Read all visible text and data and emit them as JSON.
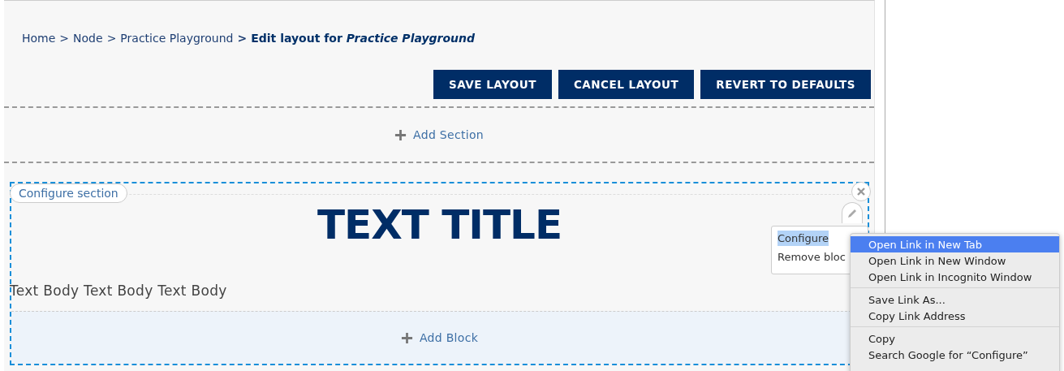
{
  "breadcrumb": {
    "links": [
      "Home",
      "Node",
      "Practice Playground"
    ],
    "separators": [
      ">",
      ">",
      ">"
    ],
    "current": "Edit layout for *Practice Playground*"
  },
  "actions": [
    "SAVE LAYOUT",
    "CANCEL LAYOUT",
    "REVERT TO DEFAULTS"
  ],
  "add_section": "Add Section",
  "section": {
    "configure": "Configure section",
    "title": "TEXT TITLE",
    "body": "Text Body Text Body Text Body",
    "add_block": "Add Block",
    "block_menu": [
      {
        "label": "Configure",
        "selected": true
      },
      {
        "label": "Remove bloc",
        "selected": false
      }
    ]
  },
  "context_menu": [
    [
      {
        "label": "Open Link in New Tab",
        "selected": true
      },
      {
        "label": "Open Link in New Window",
        "selected": false
      },
      {
        "label": "Open Link in Incognito Window",
        "selected": false
      }
    ],
    [
      {
        "label": "Save Link As...",
        "selected": false
      },
      {
        "label": "Copy Link Address",
        "selected": false
      }
    ],
    [
      {
        "label": "Copy",
        "selected": false
      },
      {
        "label": "Search Google for “Configure”",
        "selected": false
      }
    ]
  ]
}
